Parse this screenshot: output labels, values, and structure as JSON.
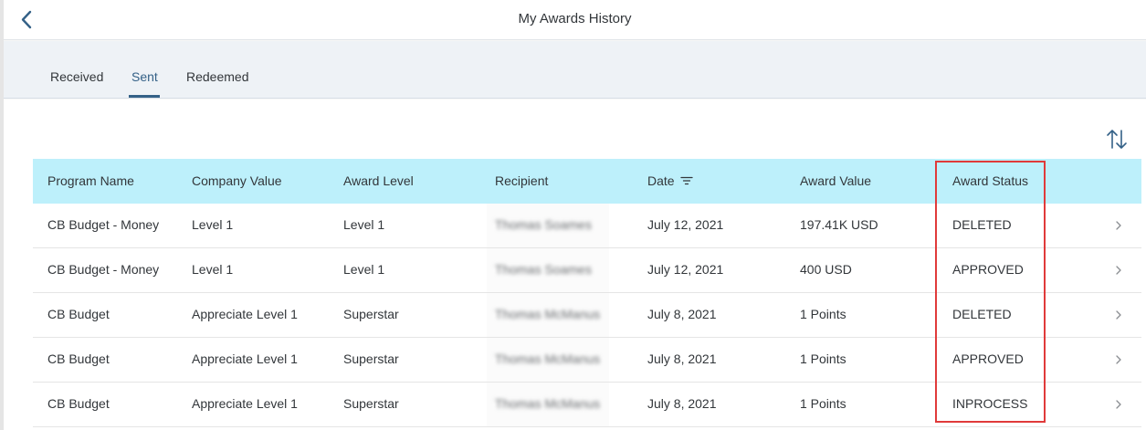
{
  "header": {
    "title": "My Awards History",
    "back_icon": "chevron-left-icon"
  },
  "tabs": [
    {
      "label": "Received",
      "active": false
    },
    {
      "label": "Sent",
      "active": true
    },
    {
      "label": "Redeemed",
      "active": false
    }
  ],
  "toolbar": {
    "sort_icon": "sort-arrows-icon"
  },
  "table": {
    "columns": [
      "Program Name",
      "Company Value",
      "Award Level",
      "Recipient",
      "Date",
      "Award Value",
      "Award Status"
    ],
    "date_filter_icon": "filter-lines-icon",
    "rows": [
      {
        "program": "CB Budget - Money",
        "company_value": "Level 1",
        "award_level": "Level 1",
        "recipient": "Thomas Soames",
        "date": "July 12, 2021",
        "award_value": "197.41K USD",
        "status": "DELETED"
      },
      {
        "program": "CB Budget - Money",
        "company_value": "Level 1",
        "award_level": "Level 1",
        "recipient": "Thomas Soames",
        "date": "July 12, 2021",
        "award_value": "400 USD",
        "status": "APPROVED"
      },
      {
        "program": "CB Budget",
        "company_value": "Appreciate Level 1",
        "award_level": "Superstar",
        "recipient": "Thomas McManus",
        "date": "July 8, 2021",
        "award_value": "1 Points",
        "status": "DELETED"
      },
      {
        "program": "CB Budget",
        "company_value": "Appreciate Level 1",
        "award_level": "Superstar",
        "recipient": "Thomas McManus",
        "date": "July 8, 2021",
        "award_value": "1 Points",
        "status": "APPROVED"
      },
      {
        "program": "CB Budget",
        "company_value": "Appreciate Level 1",
        "award_level": "Superstar",
        "recipient": "Thomas McManus",
        "date": "July 8, 2021",
        "award_value": "1 Points",
        "status": "INPROCESS"
      }
    ]
  },
  "colors": {
    "accent": "#346187",
    "header_row": "#bdf0fb",
    "highlight": "#e03a3a"
  }
}
